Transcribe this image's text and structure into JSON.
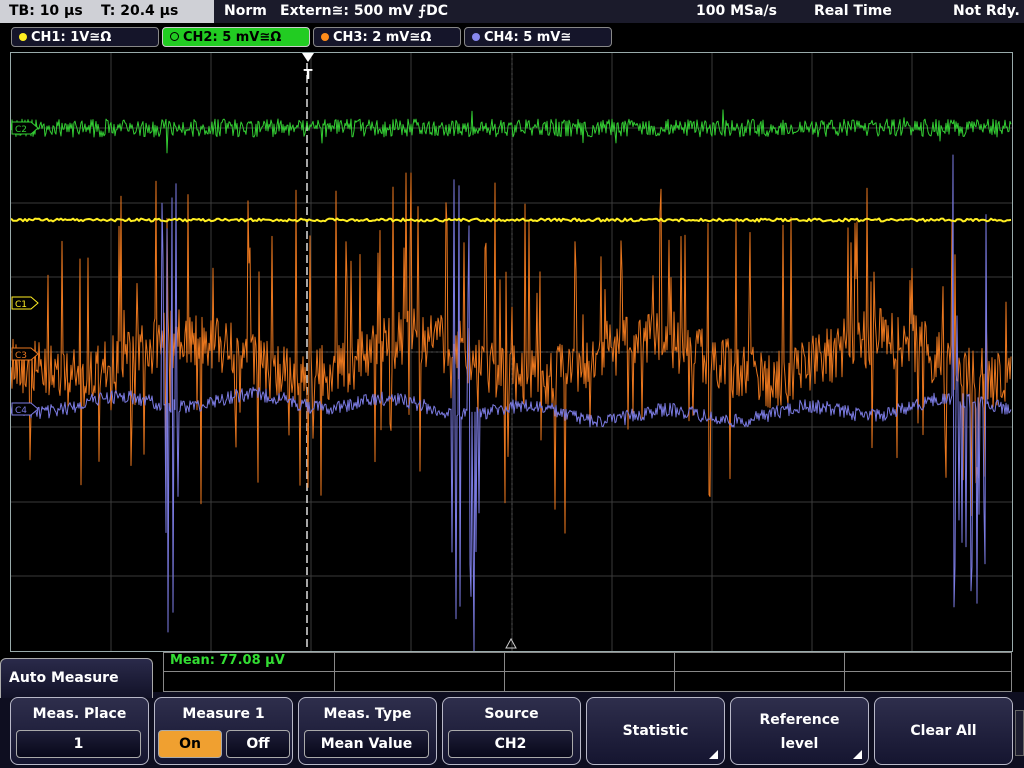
{
  "status_bar": {
    "timebase": "TB: 10 µs",
    "trigger_time": "T: 20.4 µs",
    "trigger_mode": "Norm",
    "trigger_source": "Extern≅: 500 mV ⨍DC",
    "sample_rate": "100 MSa/s",
    "acquisition_mode": "Real Time",
    "acquisition_status": "Not Rdy."
  },
  "channels": [
    {
      "label": "CH1: 1V≅Ω",
      "color": "#ffee22",
      "active": false,
      "marker": "C1"
    },
    {
      "label": "CH2: 5 mV≅Ω",
      "color": "#33cc33",
      "active": true,
      "marker": "C2"
    },
    {
      "label": "CH3: 2 mV≅Ω",
      "color": "#ff8c1a",
      "active": false,
      "marker": "C3"
    },
    {
      "label": "CH4: 5 mV≅",
      "color": "#8888ee",
      "active": false,
      "marker": "C4"
    }
  ],
  "trigger_marker": "T",
  "measurement": {
    "result": "Mean: 77.08 µV"
  },
  "menu": {
    "title": "Auto Measure",
    "softkeys": [
      {
        "title": "Meas. Place",
        "value": "1"
      },
      {
        "title": "Measure 1",
        "on": "On",
        "off": "Off",
        "selected": "On"
      },
      {
        "title": "Meas. Type",
        "value": "Mean Value"
      },
      {
        "title": "Source",
        "value": "CH2"
      },
      {
        "title": "Statistic"
      },
      {
        "title_line1": "Reference",
        "title_line2": "level"
      },
      {
        "title": "Clear All"
      }
    ]
  },
  "colors": {
    "ch1": "#ffee22",
    "ch2": "#33cc33",
    "ch3": "#e8761e",
    "ch4": "#7a7ae0",
    "active_softkey": "#f0a030"
  }
}
